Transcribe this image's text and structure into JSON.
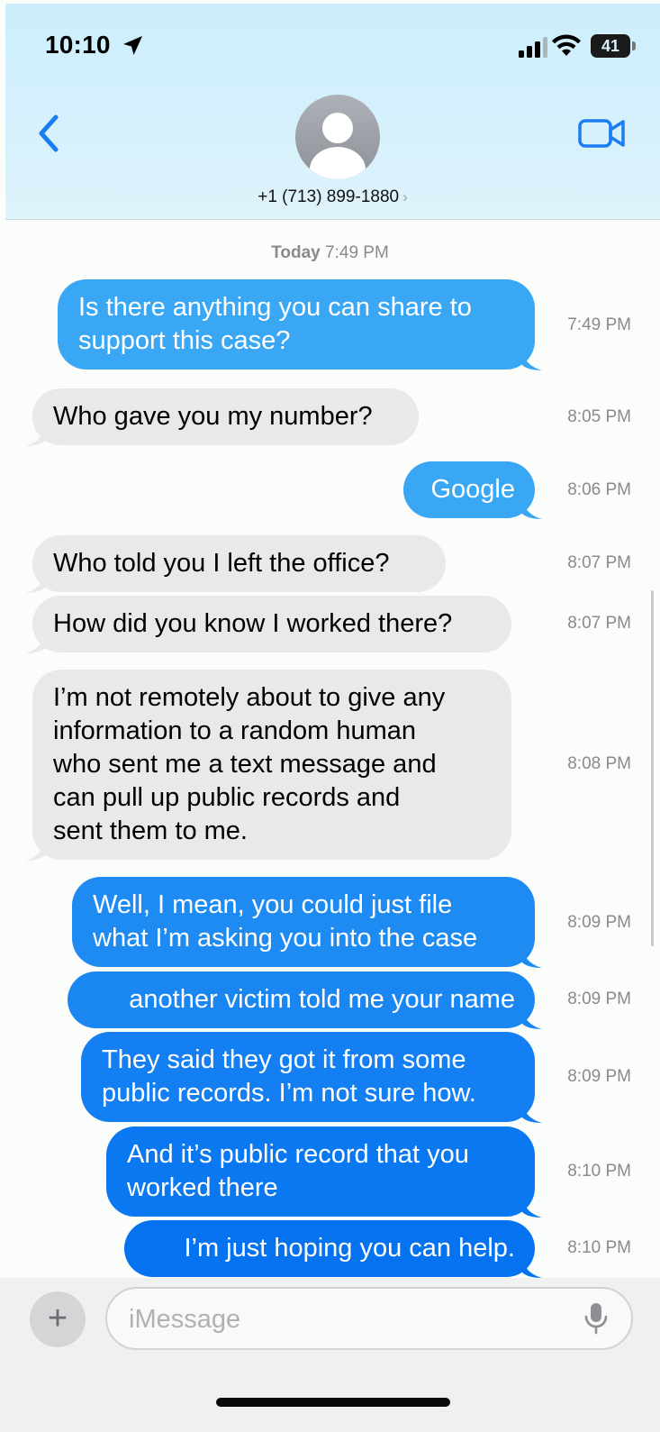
{
  "status_bar": {
    "time": "10:10",
    "battery": "41"
  },
  "header": {
    "contact_number": "+1 (713) 899-1880",
    "chevron": "›"
  },
  "daystamp": {
    "day": "Today",
    "time": "7:49 PM"
  },
  "messages": [
    {
      "dir": "out",
      "text": "Is there anything you can share to\nsupport this case?",
      "time": "7:49 PM",
      "color": "#3aa7f5"
    },
    {
      "dir": "in",
      "text": "Who gave you my number?",
      "time": "8:05 PM"
    },
    {
      "dir": "out",
      "text": "Google",
      "time": "8:06 PM",
      "color": "#3aa7f5"
    },
    {
      "dir": "in",
      "text": "Who told you I left the office?",
      "time": "8:07 PM"
    },
    {
      "dir": "in",
      "text": "How did you know I worked there?",
      "time": "8:07 PM"
    },
    {
      "dir": "in",
      "text": "I’m not remotely about to give any\ninformation to a random human\nwho sent me a text message and\ncan pull up public records and\nsent them to me.",
      "time": "8:08 PM"
    },
    {
      "dir": "out",
      "text": "Well, I mean, you could just file\nwhat I’m asking you into the case",
      "time": "8:09 PM",
      "color": "#1e8bf2"
    },
    {
      "dir": "out",
      "text": "another victim told me your name",
      "time": "8:09 PM",
      "color": "#1a86f2"
    },
    {
      "dir": "out",
      "text": "They said they got it from some\npublic records. I’m not sure how.",
      "time": "8:09 PM",
      "color": "#137ff2"
    },
    {
      "dir": "out",
      "text": "And it’s public record that you\nworked there",
      "time": "8:10 PM",
      "color": "#0a78f1"
    },
    {
      "dir": "out",
      "text": "I’m just hoping you can help.",
      "time": "8:10 PM",
      "color": "#0573f0"
    }
  ],
  "input": {
    "placeholder": "iMessage",
    "plus": "+"
  },
  "icons": {
    "back": "chevron-left-icon",
    "video": "video-camera-icon",
    "mic": "microphone-icon"
  },
  "colors": {
    "accent": "#1a7df2",
    "incoming_bubble": "#e9e9eb",
    "timestamp": "#8a8a8e"
  }
}
